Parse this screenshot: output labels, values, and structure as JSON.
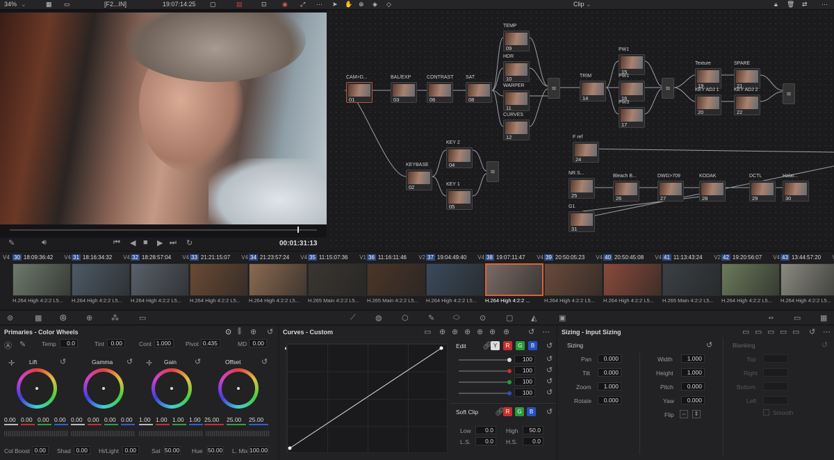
{
  "topbar": {
    "zoom": "34%",
    "clip_name": "[F2...IN]",
    "timecode": "19:07:14:25",
    "mode": "Clip"
  },
  "viewer": {
    "timecode": "00:01:31:13"
  },
  "nodes": [
    {
      "label": "CAM>D...",
      "num": "01"
    },
    {
      "label": "BAL/EXP",
      "num": "03"
    },
    {
      "label": "CONTRAST",
      "num": "06"
    },
    {
      "label": "SAT",
      "num": "08"
    },
    {
      "label": "TEMP",
      "num": "09"
    },
    {
      "label": "HDR",
      "num": "10"
    },
    {
      "label": "WARPER",
      "num": "11"
    },
    {
      "label": "CURVES",
      "num": "12"
    },
    {
      "label": "TRIM",
      "num": "14"
    },
    {
      "label": "PW1",
      "num": "15"
    },
    {
      "label": "PW1",
      "num": "16"
    },
    {
      "label": "PW3",
      "num": "17"
    },
    {
      "label": "Texture",
      "num": "19"
    },
    {
      "label": "KEY ADJ 1",
      "num": "20"
    },
    {
      "label": "SPARE",
      "num": "21"
    },
    {
      "label": "KEY ADJ 2",
      "num": "22"
    },
    {
      "label": "F ref",
      "num": "24"
    },
    {
      "label": "KEY 2",
      "num": "04"
    },
    {
      "label": "KEYBASE",
      "num": "02"
    },
    {
      "label": "KEY 1",
      "num": "05"
    },
    {
      "label": "NR S...",
      "num": "25"
    },
    {
      "label": "Bleach B...",
      "num": "26"
    },
    {
      "label": "DWG>709",
      "num": "27"
    },
    {
      "label": "KODAK",
      "num": "28"
    },
    {
      "label": "DCTL",
      "num": "29"
    },
    {
      "label": "Halat...",
      "num": "30"
    },
    {
      "label": "G1",
      "num": "31"
    }
  ],
  "clips": [
    {
      "track": "V4",
      "num": "30",
      "tc": "18:09:36:42",
      "codec": "H.264 High 4:2:2 L5...",
      "color": "#6d7a6a"
    },
    {
      "track": "V4",
      "num": "31",
      "tc": "18:16:34:32",
      "codec": "H.264 High 4:2:2 L5...",
      "color": "#4d5a66"
    },
    {
      "track": "V4",
      "num": "32",
      "tc": "18:28:57:04",
      "codec": "H.264 High 4:2:2 L5...",
      "color": "#59606a"
    },
    {
      "track": "V4",
      "num": "33",
      "tc": "21:21:15:07",
      "codec": "H.264 High 4:2:2 L5...",
      "color": "#6a4a34"
    },
    {
      "track": "V4",
      "num": "34",
      "tc": "21:23:57:24",
      "codec": "H.264 High 4:2:2 L5...",
      "color": "#8a6a50"
    },
    {
      "track": "V1",
      "num": "35",
      "tc": "11:15:07:36",
      "codec": "H.265 Main 4:2:2 L5...",
      "color": "#3a3530"
    },
    {
      "track": "V2",
      "num": "36",
      "tc": "11:16:11:46",
      "codec": "H.265 Main 4:2:2 L5...",
      "color": "#4a3528"
    },
    {
      "track": "V4",
      "num": "37",
      "tc": "19:04:49:40",
      "codec": "H.264 High 4:2:2 L5...",
      "color": "#3a4a5a"
    },
    {
      "track": "V4",
      "num": "38",
      "tc": "19:07:11:47",
      "codec": "H.264 High 4:2:2 ...",
      "color": "#7a6a64"
    },
    {
      "track": "V4",
      "num": "39",
      "tc": "20:50:05:23",
      "codec": "H.264 High 4:2:2 L5...",
      "color": "#6a4a3a"
    },
    {
      "track": "V4",
      "num": "40",
      "tc": "20:50:45:08",
      "codec": "H.264 High 4:2:2 L5...",
      "color": "#8a4a3a"
    },
    {
      "track": "V2",
      "num": "41",
      "tc": "11:13:43:24",
      "codec": "H.265 Main 4:2:2 L5...",
      "color": "#3a4045"
    },
    {
      "track": "V4",
      "num": "42",
      "tc": "19:20:56:07",
      "codec": "H.264 High 4:2:2 L5...",
      "color": "#6a7a5a"
    },
    {
      "track": "V4",
      "num": "43",
      "tc": "13:44:57:20",
      "codec": "H.264 High 4:2:2 L5...",
      "color": "#8a8a80"
    }
  ],
  "primaries": {
    "title": "Primaries - Color Wheels",
    "temp_label": "Temp",
    "temp": "0.0",
    "tint_label": "Tint",
    "tint": "0.00",
    "cont_label": "Cont",
    "cont": "1.000",
    "pivot_label": "Pivot",
    "pivot": "0.435",
    "md_label": "MD",
    "md": "0.00",
    "wheels": [
      {
        "name": "Lift",
        "values": [
          "0.00",
          "0.00",
          "0.00",
          "0.00"
        ]
      },
      {
        "name": "Gamma",
        "values": [
          "0.00",
          "0.00",
          "0.00",
          "0.00"
        ]
      },
      {
        "name": "Gain",
        "values": [
          "1.00",
          "1.00",
          "1.00",
          "1.00"
        ]
      },
      {
        "name": "Offset",
        "values": [
          "25.00",
          "25.00",
          "25.00"
        ]
      }
    ],
    "bottom": [
      {
        "label": "Col Boost",
        "value": "0.00"
      },
      {
        "label": "Shad",
        "value": "0.00"
      },
      {
        "label": "Hi/Light",
        "value": "0.00"
      },
      {
        "label": "Sat",
        "value": "50.00"
      },
      {
        "label": "Hue",
        "value": "50.00"
      },
      {
        "label": "L. Mix",
        "value": "100.00"
      }
    ]
  },
  "curves": {
    "title": "Curves - Custom",
    "edit_label": "Edit",
    "channels": [
      "Y",
      "R",
      "G",
      "B"
    ],
    "values": [
      "100",
      "100",
      "100",
      "100"
    ],
    "softclip_label": "Soft Clip",
    "low_label": "Low",
    "low": "0.0",
    "high_label": "High",
    "high": "50.0",
    "ls_label": "L.S.",
    "ls": "0.0",
    "hs_label": "H.S.",
    "hs": "0.0"
  },
  "sizing": {
    "title": "Sizing - Input Sizing",
    "section": "Sizing",
    "pan_label": "Pan",
    "pan": "0.000",
    "tilt_label": "Tilt",
    "tilt": "0.000",
    "zoom_label": "Zoom",
    "zoom": "1.000",
    "rotate_label": "Rotate",
    "rotate": "0.000",
    "width_label": "Width",
    "width": "1.000",
    "height_label": "Height",
    "height": "1.000",
    "pitch_label": "Pitch",
    "pitch": "0.000",
    "yaw_label": "Yaw",
    "yaw": "0.000",
    "flip_label": "Flip",
    "blanking": "Blanking",
    "top": "Top",
    "right": "Right",
    "bottom": "Bottom",
    "left": "Left",
    "smooth": "Smooth"
  }
}
